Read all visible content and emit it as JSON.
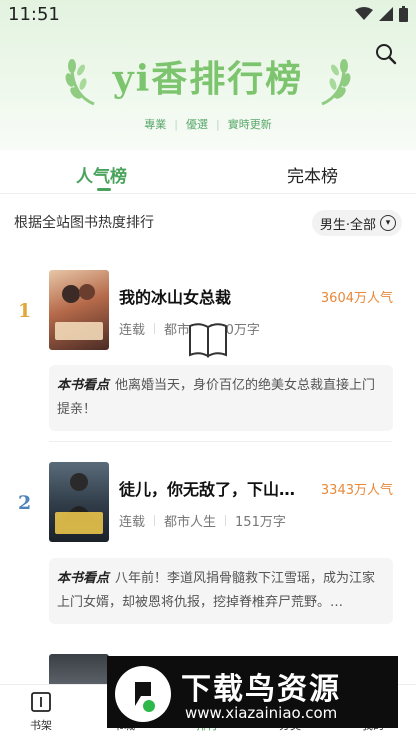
{
  "status": {
    "time": "11:51"
  },
  "brand": {
    "title": "yi香排行榜",
    "tags": [
      "專業",
      "優選",
      "實時更新"
    ]
  },
  "tabs": [
    {
      "label": "人气榜"
    },
    {
      "label": "完本榜"
    }
  ],
  "subhead": "根据全站图书热度排行",
  "filter": {
    "label": "男生·全部"
  },
  "books": [
    {
      "rank": "1",
      "rank_color": "#e0a83a",
      "title": "我的冰山女总裁",
      "popularity": "3604万人气",
      "status": "连载",
      "genre": "都市",
      "words": "240万字",
      "blurb_label": "本书看点",
      "blurb": "他离婚当天，身价百亿的绝美女总裁直接上门提亲！"
    },
    {
      "rank": "2",
      "rank_color": "#4e84b9",
      "title": "徒儿，你无敌了，下山…",
      "popularity": "3343万人气",
      "status": "连载",
      "genre": "都市人生",
      "words": "151万字",
      "blurb_label": "本书看点",
      "blurb": "八年前！李道风捐骨髓救下江雪瑶，成为江家上门女婿，却被恩将仇报，挖掉脊椎弃尸荒野。…"
    }
  ],
  "nav": [
    {
      "label": "书架",
      "icon": "bookshelf-icon"
    },
    {
      "label": "书城",
      "icon": "bookstore-icon"
    },
    {
      "label": "排行",
      "icon": "ranking-icon"
    },
    {
      "label": "分类",
      "icon": "category-icon"
    },
    {
      "label": "我的",
      "icon": "profile-icon"
    }
  ],
  "watermark": {
    "title": "下载鸟资源",
    "url": "www.xiazainiao.com"
  },
  "colors": {
    "accent": "#4aa35c",
    "popularity": "#e8893a"
  }
}
